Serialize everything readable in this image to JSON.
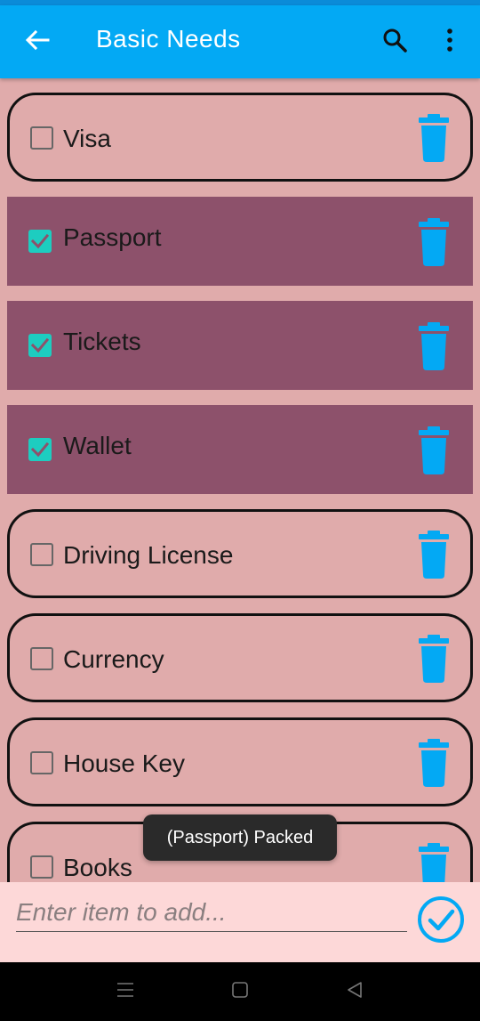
{
  "app_bar": {
    "title": "Basic Needs",
    "background_color": "#03A9F4",
    "icons": [
      "back-arrow-icon",
      "search-icon",
      "more-vert-icon"
    ]
  },
  "items": [
    {
      "label": "Visa",
      "checked": false
    },
    {
      "label": "Passport",
      "checked": true
    },
    {
      "label": "Tickets",
      "checked": true
    },
    {
      "label": "Wallet",
      "checked": true
    },
    {
      "label": "Driving License",
      "checked": false
    },
    {
      "label": "Currency",
      "checked": false
    },
    {
      "label": "House Key",
      "checked": false
    },
    {
      "label": "Books",
      "checked": false
    }
  ],
  "toast": {
    "message": "(Passport) Packed"
  },
  "input": {
    "placeholder": "Enter item to add...",
    "value": ""
  },
  "colors": {
    "background": "#E0ABAB",
    "checked_item_background": "#8D516B",
    "checkbox_checked": "#1DCDC0",
    "trash_icon": "#03A9F4",
    "input_bar_background": "#FDD8D8",
    "submit_icon": "#03A9F4"
  },
  "nav_bar": {
    "buttons": [
      "recents-icon",
      "home-icon",
      "back-icon"
    ]
  }
}
